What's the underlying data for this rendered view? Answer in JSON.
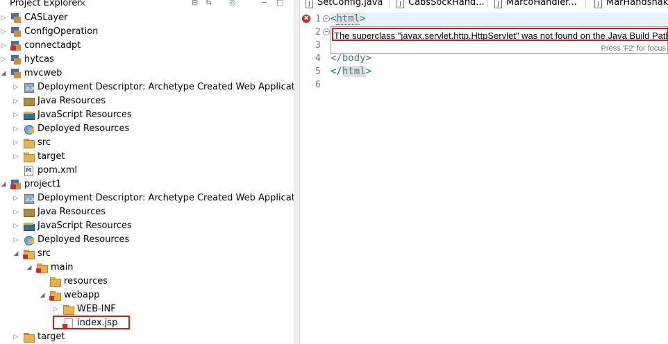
{
  "explorer": {
    "title": "Project Explorer",
    "close_glyph": "✕",
    "items": [
      {
        "label": "CASLayer"
      },
      {
        "label": "ConfigOperation"
      },
      {
        "label": "connectadpt"
      },
      {
        "label": "hytcas"
      },
      {
        "label": "mvcweb"
      },
      {
        "label": "Deployment Descriptor: Archetype Created Web Application"
      },
      {
        "label": "Java Resources"
      },
      {
        "label": "JavaScript Resources"
      },
      {
        "label": "Deployed Resources"
      },
      {
        "label": "src"
      },
      {
        "label": "target"
      },
      {
        "label": "pom.xml"
      },
      {
        "label": "project1"
      },
      {
        "label": "Deployment Descriptor: Archetype Created Web Application"
      },
      {
        "label": "Java Resources"
      },
      {
        "label": "JavaScript Resources"
      },
      {
        "label": "Deployed Resources"
      },
      {
        "label": "src"
      },
      {
        "label": "main"
      },
      {
        "label": "resources"
      },
      {
        "label": "webapp"
      },
      {
        "label": "WEB-INF"
      },
      {
        "label": "index.jsp"
      },
      {
        "label": "target"
      }
    ]
  },
  "editor": {
    "tabs": [
      {
        "label": "SetConfig.java"
      },
      {
        "label": "CabsSockHand..."
      },
      {
        "label": "MarcoHandler..."
      },
      {
        "label": "MarHandshake"
      }
    ],
    "line_numbers": [
      "1",
      "2",
      "3",
      "4",
      "5",
      "6"
    ],
    "lines": {
      "l1_open": "<",
      "l1_tag": "html",
      "l1_close": ">",
      "l4": "</body>",
      "l5_open": "</",
      "l5_tag": "html",
      "l5_close": ">"
    },
    "error_glyph": "✖",
    "tooltip": {
      "message": "The superclass \"javax.servlet.http.HttpServlet\" was not found on the Java Build Path",
      "footer": "Press 'F2' for focus"
    }
  },
  "colors": {
    "error_red": "#d01919",
    "tag_teal": "#3f7f7f",
    "selection_blue": "#e8f2fe"
  }
}
